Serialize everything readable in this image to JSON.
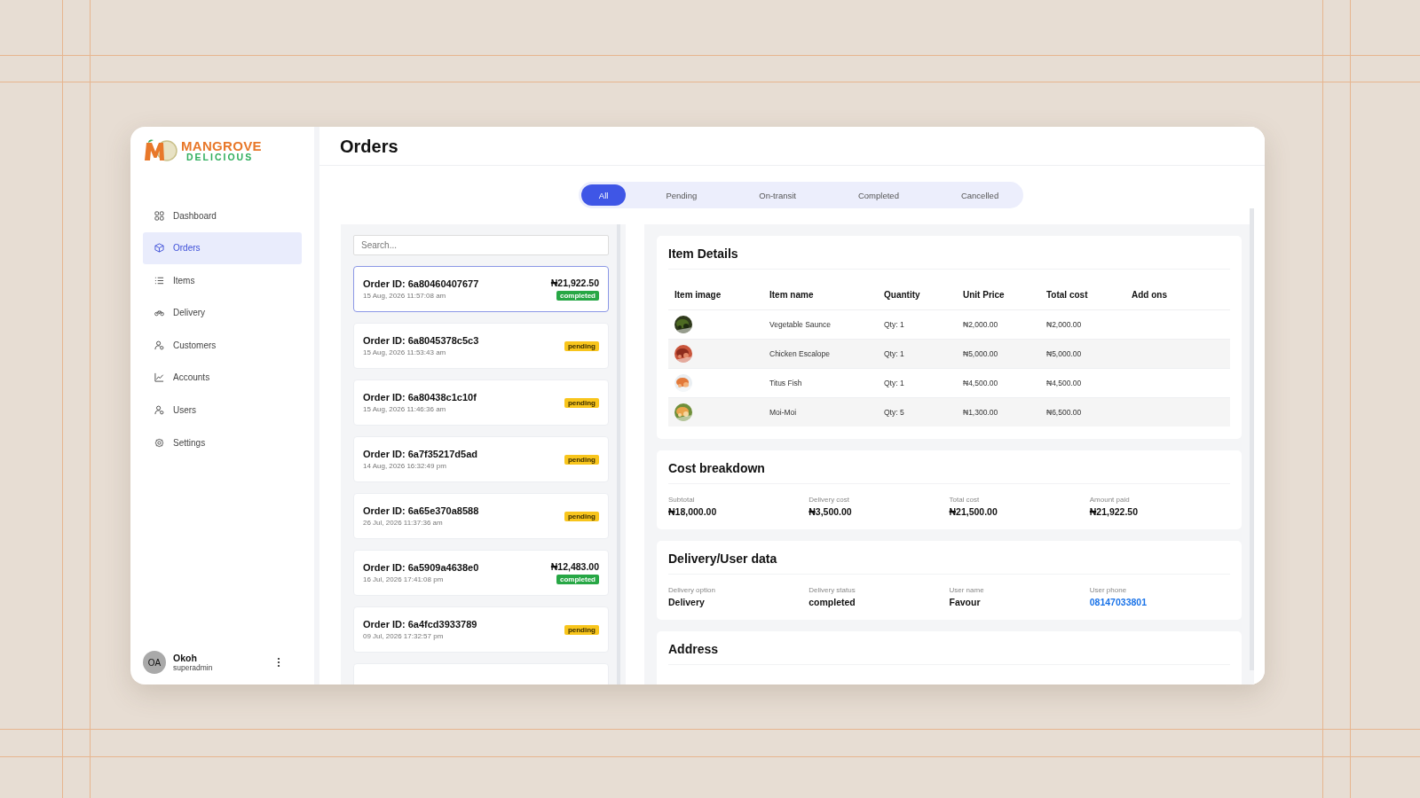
{
  "brand": {
    "line_1": "MANGROVE",
    "line_2": "DELICIOUS"
  },
  "sidebar": {
    "items": [
      {
        "label": "Dashboard",
        "selected": false
      },
      {
        "label": "Orders",
        "selected": true
      },
      {
        "label": "Items",
        "selected": false
      },
      {
        "label": "Delivery",
        "selected": false
      },
      {
        "label": "Customers",
        "selected": false
      },
      {
        "label": "Accounts",
        "selected": false
      },
      {
        "label": "Users",
        "selected": false
      },
      {
        "label": "Settings",
        "selected": false
      }
    ],
    "user": {
      "initials": "OA",
      "name": "Okoh",
      "role": "superadmin"
    }
  },
  "page_title": "Orders",
  "tabs": [
    {
      "label": "All",
      "selected": true
    },
    {
      "label": "Pending",
      "selected": false
    },
    {
      "label": "On-transit",
      "selected": false
    },
    {
      "label": "Completed",
      "selected": false
    },
    {
      "label": "Cancelled",
      "selected": false
    }
  ],
  "search": {
    "placeholder": "Search..."
  },
  "orders": [
    {
      "title": "Order ID: 6a80460407677",
      "date": "15 Aug, 2026 11:57:08 am",
      "amount": "₦21,922.50",
      "status": "completed",
      "selected": true
    },
    {
      "title": "Order ID: 6a8045378c5c3",
      "date": "15 Aug, 2026 11:53:43 am",
      "status": "pending",
      "selected": false
    },
    {
      "title": "Order ID: 6a80438c1c10f",
      "date": "15 Aug, 2026 11:46:36 am",
      "status": "pending",
      "selected": false
    },
    {
      "title": "Order ID: 6a7f35217d5ad",
      "date": "14 Aug, 2026 16:32:49 pm",
      "status": "pending",
      "selected": false
    },
    {
      "title": "Order ID: 6a65e370a8588",
      "date": "26 Jul, 2026 11:37:36 am",
      "status": "pending",
      "selected": false
    },
    {
      "title": "Order ID: 6a5909a4638e0",
      "date": "16 Jul, 2026 17:41:08 pm",
      "amount": "₦12,483.00",
      "status": "completed",
      "selected": false
    },
    {
      "title": "Order ID: 6a4fcd3933789",
      "date": "09 Jul, 2026 17:32:57 pm",
      "status": "pending",
      "selected": false
    }
  ],
  "item_details": {
    "title": "Item Details",
    "columns": [
      "Item image",
      "Item name",
      "Quantity",
      "Unit Price",
      "Total cost",
      "Add ons"
    ],
    "rows": [
      {
        "name": "Vegetable Saunce",
        "quantity": "Qty: 1",
        "unit_price": "₦2,000.00",
        "total_cost": "₦2,000.00"
      },
      {
        "name": "Chicken Escalope",
        "quantity": "Qty: 1",
        "unit_price": "₦5,000.00",
        "total_cost": "₦5,000.00"
      },
      {
        "name": "Titus Fish",
        "quantity": "Qty: 1",
        "unit_price": "₦4,500.00",
        "total_cost": "₦4,500.00"
      },
      {
        "name": "Moi-Moi",
        "quantity": "Qty: 5",
        "unit_price": "₦1,300.00",
        "total_cost": "₦6,500.00"
      }
    ]
  },
  "cost_breakdown": {
    "title": "Cost breakdown",
    "fields": [
      {
        "label": "Subtotal",
        "value": "₦18,000.00"
      },
      {
        "label": "Delivery cost",
        "value": "₦3,500.00"
      },
      {
        "label": "Total cost",
        "value": "₦21,500.00"
      },
      {
        "label": "Amount paid",
        "value": "₦21,922.50"
      }
    ]
  },
  "delivery_user_data": {
    "title": "Delivery/User data",
    "fields": [
      {
        "label": "Delivery option",
        "value": "Delivery",
        "kind": "text"
      },
      {
        "label": "Delivery status",
        "value": "completed",
        "kind": "text"
      },
      {
        "label": "User name",
        "value": "Favour",
        "kind": "text"
      },
      {
        "label": "User phone",
        "value": "08147033801",
        "kind": "link"
      }
    ]
  },
  "address": {
    "title": "Address"
  }
}
